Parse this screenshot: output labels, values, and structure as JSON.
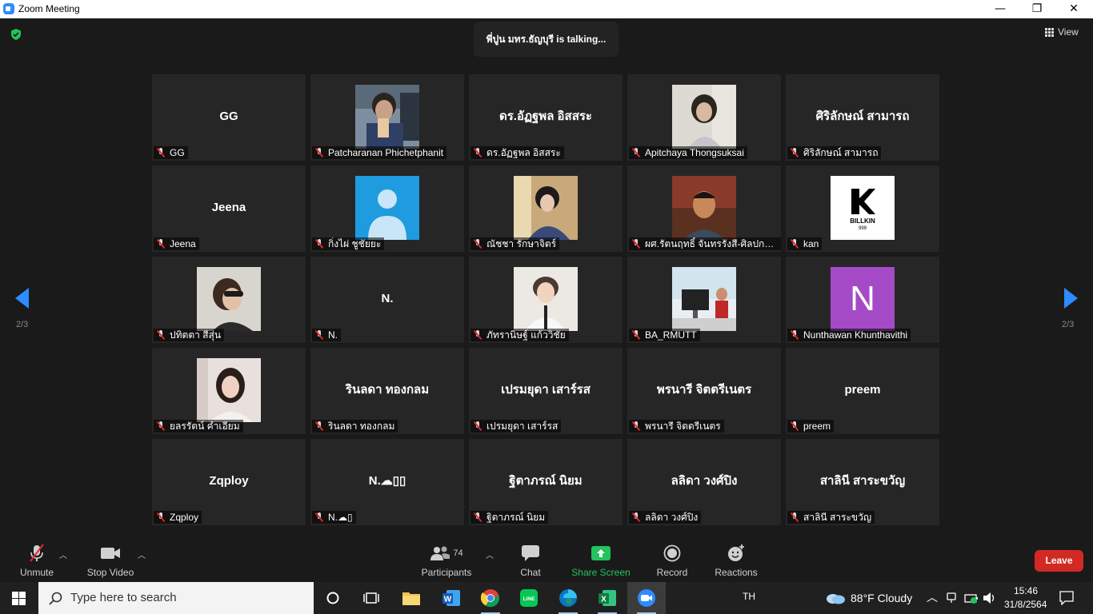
{
  "window": {
    "title": "Zoom Meeting",
    "minimize": "—",
    "maximize": "❐",
    "close": "✕"
  },
  "meeting": {
    "talking": "พี่ปูน มทร.ธัญบุรี is  talking...",
    "view_label": "View",
    "page_left": "2/3",
    "page_right": "2/3"
  },
  "tiles": [
    {
      "big": "GG",
      "name": "GG"
    },
    {
      "name": "Patcharanan Phichetphanit",
      "photo": true
    },
    {
      "big": "ดร.อัฏฐพล อิสสระ",
      "name": "ดร.อัฏฐพล อิสสระ"
    },
    {
      "name": "Apitchaya Thongsuksai",
      "photo": true
    },
    {
      "big": "ศิริลักษณ์ สามารถ",
      "name": "ศิริลักษณ์ สามารถ"
    },
    {
      "big": "Jeena",
      "name": "Jeena"
    },
    {
      "name": "กิ่งไผ่ ชูชัยยะ",
      "photo": true
    },
    {
      "name": "ณัชชา รักษาจิตร์",
      "photo": true
    },
    {
      "name": "ผศ.รัตนฤทธิ์ จันทรรังสี-ศิลปกรร...",
      "photo": true
    },
    {
      "name": "kan",
      "photo": true,
      "logo_text": "BILLKIN",
      "logo_sub": "999"
    },
    {
      "name": "ปทิตตา สีสุ่น",
      "photo": true
    },
    {
      "big": "N.",
      "name": "N."
    },
    {
      "name": "ภัทรานิษฐ์ แก้ววิชัย",
      "photo": true
    },
    {
      "name": "BA_RMUTT",
      "photo": true
    },
    {
      "name": "Nunthawan Khunthavithi",
      "photo": true,
      "letter": "N"
    },
    {
      "name": "ยลรรัตน์ คำเอียม",
      "photo": true
    },
    {
      "big": "รินลดา ทองกลม",
      "name": "รินลดา ทองกลม"
    },
    {
      "big": "เปรมยุดา เสาร์รส",
      "name": "เปรมยุดา เสาร์รส"
    },
    {
      "big": "พรนารี จิตตรีเนตร",
      "name": "พรนารี จิตตรีเนตร"
    },
    {
      "big": "preem",
      "name": "preem"
    },
    {
      "big": "Zqploy",
      "name": "Zqploy"
    },
    {
      "big": "N.☁▯▯",
      "name": "N.☁▯"
    },
    {
      "big": "ฐิตาภรณ์ นิยม",
      "name": "ฐิตาภรณ์ นิยม"
    },
    {
      "big": "ลลิดา วงศ์ปิง",
      "name": "ลลิดา วงศ์ปิง"
    },
    {
      "big": "สาลินี สาระขวัญ",
      "name": "สาลินี สาระขวัญ"
    }
  ],
  "toolbar": {
    "unmute": "Unmute",
    "stop_video": "Stop Video",
    "participants": "Participants",
    "participants_count": "74",
    "chat": "Chat",
    "share_screen": "Share Screen",
    "record": "Record",
    "reactions": "Reactions",
    "leave": "Leave"
  },
  "taskbar": {
    "search_placeholder": "Type here to search",
    "language": "TH",
    "weather": "88°F  Cloudy",
    "time": "15:46",
    "date": "31/8/2564"
  },
  "colors": {
    "accent": "#2d8cff",
    "leave": "#d12a24",
    "share": "#23c35e",
    "tile": "#262626"
  }
}
